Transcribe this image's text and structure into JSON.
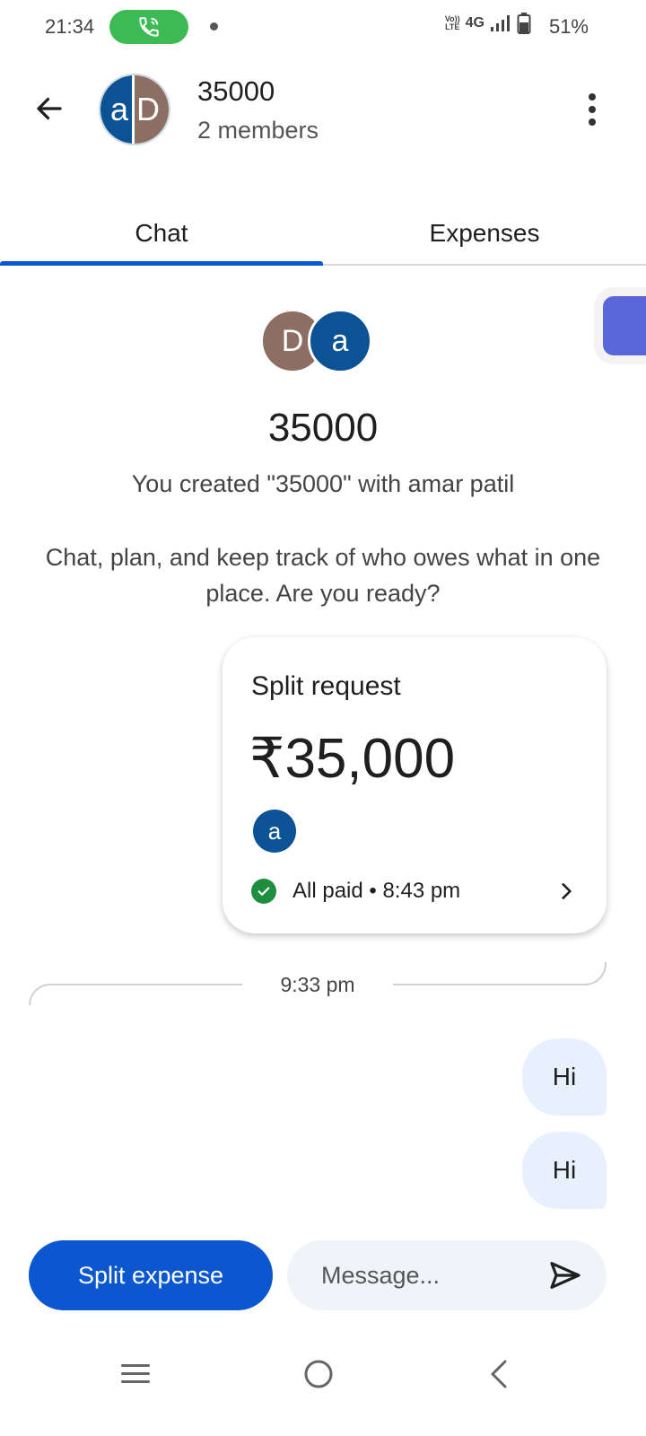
{
  "status_bar": {
    "time": "21:34",
    "network_top": "Vo))",
    "network_bottom": "LTE",
    "network_type": "4G",
    "battery": "51%"
  },
  "header": {
    "avatar_left": "a",
    "avatar_right": "D",
    "title": "35000",
    "subtitle": "2 members"
  },
  "tabs": [
    {
      "label": "Chat",
      "active": true
    },
    {
      "label": "Expenses",
      "active": false
    }
  ],
  "intro": {
    "avatar_first": "D",
    "avatar_second": "a",
    "title": "35000",
    "created_text": "You created \"35000\" with amar patil",
    "description": "Chat, plan, and keep track of who owes what in one place. Are you ready?"
  },
  "split_card": {
    "label": "Split request",
    "amount": "₹35,000",
    "payer_initial": "a",
    "status": "All paid • 8:43 pm"
  },
  "divider_time": "9:33 pm",
  "messages": [
    {
      "text": "Hi"
    },
    {
      "text": "Hi"
    }
  ],
  "composer": {
    "split_button": "Split expense",
    "placeholder": "Message..."
  },
  "colors": {
    "primary": "#0b57d0",
    "avatar_blue": "#0b5394",
    "avatar_brown": "#8d6e63",
    "call_green": "#3cba54",
    "paid_green": "#1e8e3e",
    "bubble": "#e8f0fe"
  },
  "icons": {
    "call": "phone-call-icon",
    "back": "arrow-left-icon",
    "more": "more-vert-icon",
    "check": "check-circle-icon",
    "chevron": "chevron-right-icon",
    "send": "send-icon",
    "nav_menu": "menu-icon",
    "nav_home": "home-circle-icon",
    "nav_back": "chevron-left-icon"
  }
}
